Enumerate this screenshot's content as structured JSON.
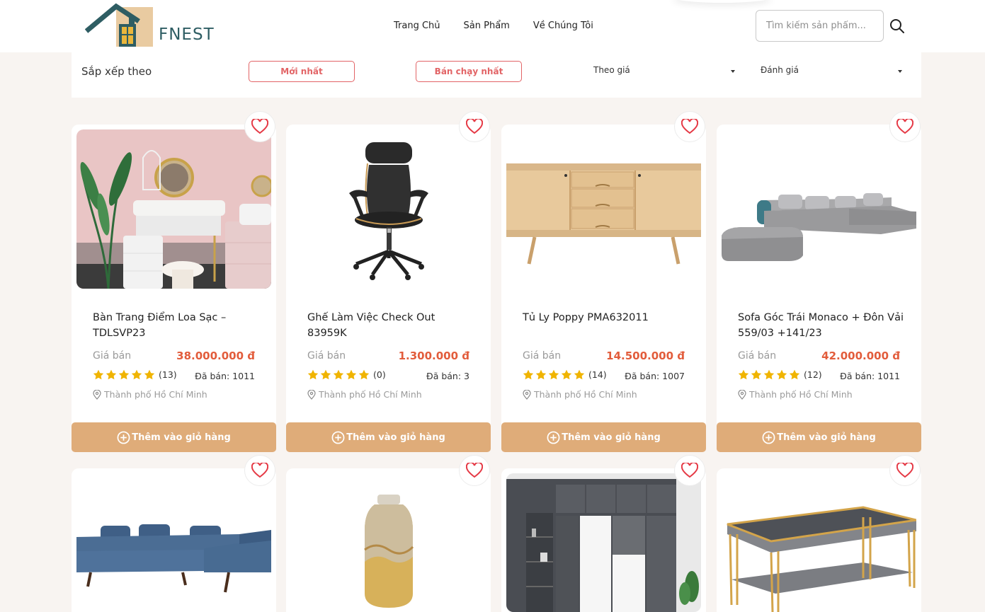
{
  "header": {
    "logo_text": "FNEST",
    "nav": [
      "Trang Chủ",
      "Sản Phẩm",
      "Về Chúng Tôi"
    ],
    "search_placeholder": "Tìm kiếm sản phẩm..."
  },
  "sortbar": {
    "label": "Sắp xếp theo",
    "newest": "Mới nhất",
    "bestseller": "Bán chạy nhất",
    "by_price": "Theo giá",
    "by_rating": "Đánh giá"
  },
  "card_common": {
    "price_label": "Giá bán",
    "add_to_cart": "Thêm vào giỏ hàng",
    "sold_prefix": "Đã bán:"
  },
  "colors": {
    "accent_button": "#dfac79",
    "price": "#e25c3b",
    "sort_button": "#e26466",
    "star": "#f0b400",
    "logo": "#2e5d63"
  },
  "products": [
    {
      "title": "Bàn Trang Điểm Loa Sạc – TDLSVP23",
      "price": "38.000.000 đ",
      "rating_count": "(13)",
      "sold": "Đã bán: 1011",
      "location": "Thành phố Hồ Chí Minh"
    },
    {
      "title": "Ghế Làm Việc Check Out 83959K",
      "price": "1.300.000 đ",
      "rating_count": "(0)",
      "sold": "Đã bán: 3",
      "location": "Thành phố Hồ Chí Minh"
    },
    {
      "title": "Tủ Ly Poppy PMA632011",
      "price": "14.500.000 đ",
      "rating_count": "(14)",
      "sold": "Đã bán: 1007",
      "location": "Thành phố Hồ Chí Minh"
    },
    {
      "title": "Sofa Góc Trái Monaco + Đôn Vải 559/03 +141/23",
      "price": "42.000.000 đ",
      "rating_count": "(12)",
      "sold": "Đã bán: 1011",
      "location": "Thành phố Hồ Chí Minh"
    }
  ]
}
